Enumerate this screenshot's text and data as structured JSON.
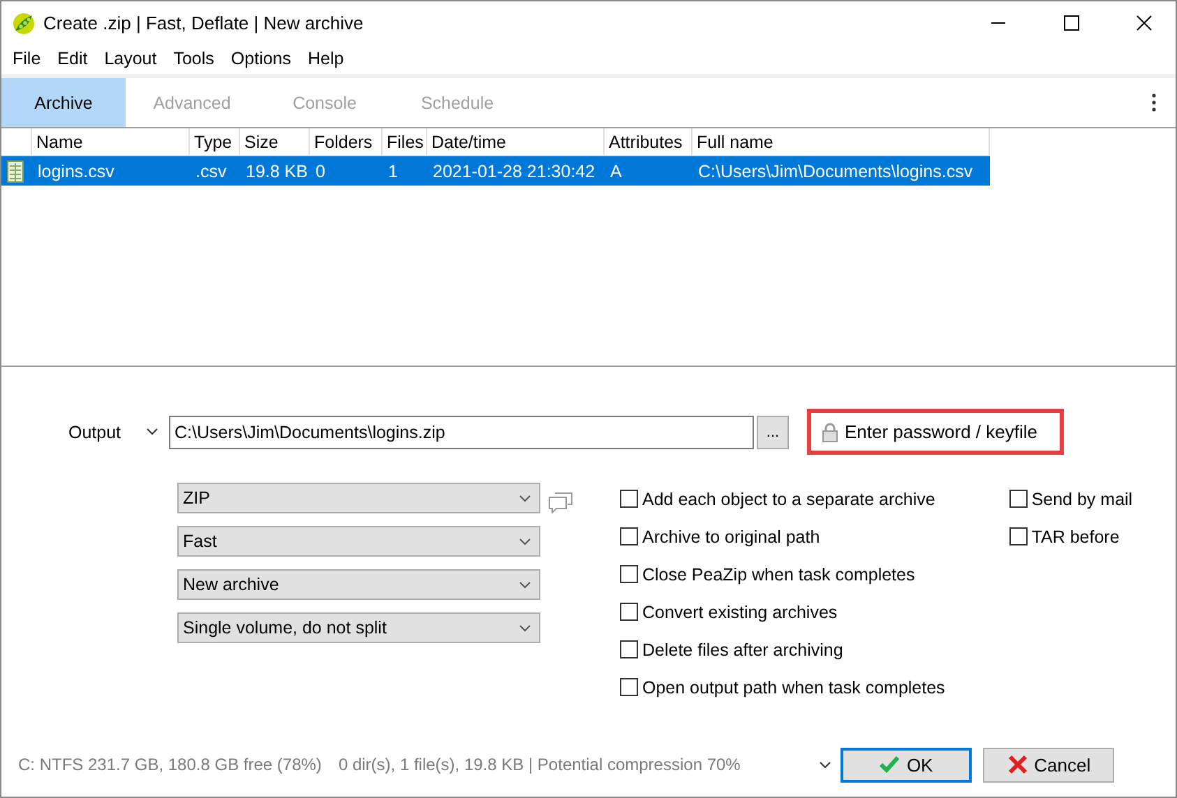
{
  "window": {
    "title": "Create .zip | Fast, Deflate | New archive"
  },
  "menu": [
    "File",
    "Edit",
    "Layout",
    "Tools",
    "Options",
    "Help"
  ],
  "tabs": [
    {
      "label": "Archive",
      "selected": true
    },
    {
      "label": "Advanced",
      "selected": false
    },
    {
      "label": "Console",
      "selected": false
    },
    {
      "label": "Schedule",
      "selected": false
    }
  ],
  "table": {
    "columns": [
      "Name",
      "Type",
      "Size",
      "Folders",
      "Files",
      "Date/time",
      "Attributes",
      "Full name"
    ],
    "rows": [
      {
        "selected": true,
        "cells": [
          "logins.csv",
          ".csv",
          "19.8 KB",
          "0",
          "1",
          "2021-01-28 21:30:42",
          "A",
          "C:\\Users\\Jim\\Documents\\logins.csv"
        ]
      }
    ]
  },
  "output": {
    "label": "Output",
    "value": "C:\\Users\\Jim\\Documents\\logins.zip",
    "browse": "...",
    "password_button": {
      "label": "Enter password / keyfile",
      "highlighted": true
    }
  },
  "dropdowns": [
    {
      "value": "ZIP"
    },
    {
      "value": "Fast"
    },
    {
      "value": "New archive"
    },
    {
      "value": "Single volume, do not split"
    }
  ],
  "checkboxes": [
    {
      "label": "Add each object to a separate archive",
      "checked": false
    },
    {
      "label": "Archive to original path",
      "checked": false
    },
    {
      "label": "Close PeaZip when task completes",
      "checked": false
    },
    {
      "label": "Convert existing archives",
      "checked": false
    },
    {
      "label": "Delete files after archiving",
      "checked": false
    },
    {
      "label": "Open output path when task completes",
      "checked": false
    }
  ],
  "side_checkboxes": [
    {
      "label": "Send by mail",
      "checked": false
    },
    {
      "label": "TAR before",
      "checked": false
    }
  ],
  "status_bar": [
    "C: NTFS 231.7 GB, 180.8 GB free (78%)",
    "0 dir(s), 1 file(s), 19.8 KB | Potential compression 70%"
  ],
  "buttons": [
    {
      "label": "OK",
      "kind": "ok"
    },
    {
      "label": "Cancel",
      "kind": "cancel"
    }
  ]
}
